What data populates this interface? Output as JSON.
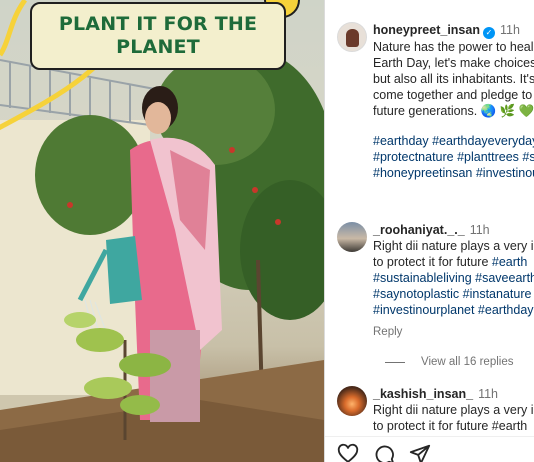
{
  "banner": {
    "text": "PLANT IT FOR THE PLANET"
  },
  "post": {
    "username": "honeypreet_insan",
    "time": "11h",
    "caption_lines": [
      "Nature has the power to heal",
      "Earth Day, let's make choices",
      "but also all its inhabitants. It's",
      "come together and pledge to",
      "future generations. 🌏 🌿 💚"
    ],
    "hashtag_lines": [
      "#earthday #earthdayeveryday",
      "#protectnature #planttrees #s",
      "#honeypreetinsan #investinou"
    ]
  },
  "comments": [
    {
      "username": "_roohaniyat._._",
      "time": "11h",
      "lines": [
        "Right dii nature plays a very im",
        "to protect it for future #earth",
        "#sustainableliving #saveearth",
        "#saynotoplastic #instanature",
        "#investinourplanet #earthday"
      ],
      "reply_label": "Reply"
    },
    {
      "username": "_kashish_insan_",
      "time": "11h",
      "lines": [
        "Right dii nature plays a very in",
        "to protect it for future #earth"
      ]
    }
  ],
  "view_replies_label": "View all 16 replies",
  "colors": {
    "link": "#00376b",
    "verified": "#0095f6",
    "banner_text": "#1e6b3a",
    "banner_bg": "#f3efcd"
  },
  "icons": [
    "heart-icon",
    "comment-icon",
    "share-icon"
  ]
}
